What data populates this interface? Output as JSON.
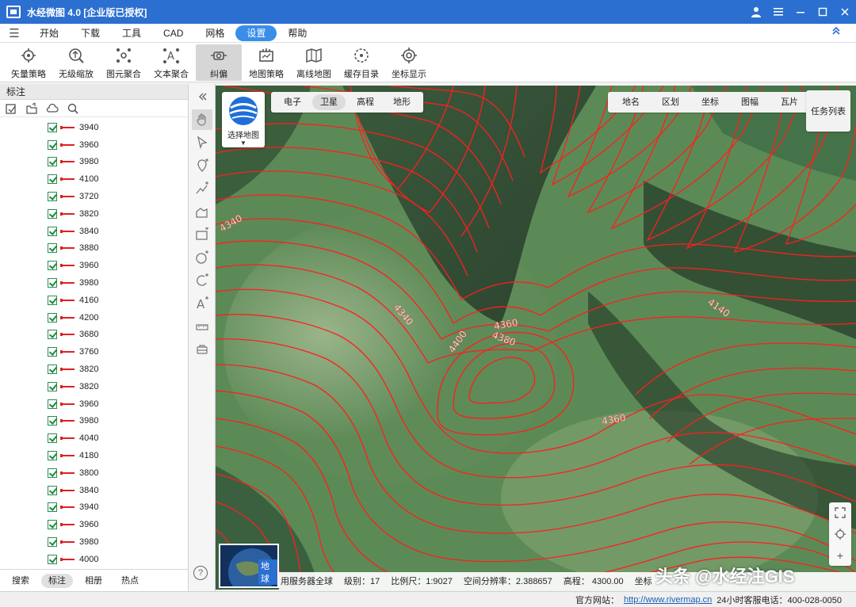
{
  "window": {
    "title": "水经微图 4.0 [企业版已授权]",
    "controls": [
      "user-icon",
      "menu-icon",
      "minimize-icon",
      "maximize-icon",
      "close-icon"
    ]
  },
  "menu": {
    "items": [
      {
        "label": "开始"
      },
      {
        "label": "下载"
      },
      {
        "label": "工具"
      },
      {
        "label": "CAD"
      },
      {
        "label": "网格"
      },
      {
        "label": "设置",
        "active": true
      },
      {
        "label": "帮助"
      }
    ]
  },
  "toolbar": {
    "items": [
      {
        "label": "矢量策略",
        "icon": "vector-strategy-icon"
      },
      {
        "label": "无级缩放",
        "icon": "stepless-zoom-icon"
      },
      {
        "label": "图元聚合",
        "icon": "feature-cluster-icon"
      },
      {
        "label": "文本聚合",
        "icon": "text-cluster-icon"
      },
      {
        "label": "纠偏",
        "icon": "offset-correction-icon",
        "active": true
      },
      {
        "label": "地图策略",
        "icon": "map-strategy-icon"
      },
      {
        "label": "离线地图",
        "icon": "offline-map-icon"
      },
      {
        "label": "缓存目录",
        "icon": "cache-folder-icon"
      },
      {
        "label": "坐标显示",
        "icon": "coordinate-display-icon"
      }
    ]
  },
  "left_panel": {
    "header": "标注",
    "layers": [
      "3940",
      "3960",
      "3980",
      "4100",
      "3720",
      "3820",
      "3840",
      "3880",
      "3960",
      "3980",
      "4160",
      "4200",
      "3680",
      "3760",
      "3820",
      "3820",
      "3960",
      "3980",
      "4040",
      "4180",
      "3800",
      "3840",
      "3940",
      "3960",
      "3980",
      "4000"
    ],
    "tabs": [
      {
        "label": "搜索"
      },
      {
        "label": "标注",
        "active": true
      },
      {
        "label": "相册"
      },
      {
        "label": "热点"
      }
    ]
  },
  "map": {
    "chooser_label": "选择地图",
    "type_tabs": [
      {
        "label": "电子"
      },
      {
        "label": "卫星",
        "active": true
      },
      {
        "label": "高程"
      },
      {
        "label": "地形"
      }
    ],
    "overlay_tabs": [
      "地名",
      "区划",
      "坐标",
      "图幅",
      "瓦片"
    ],
    "task_list": "任务列表",
    "contour_labels": [
      "4340",
      "4340",
      "4400",
      "4360",
      "4380",
      "4140",
      "4360"
    ],
    "minimap_label": "地球",
    "status": {
      "server": "用服务器全球",
      "level": "级别：17",
      "scale": "比例尺：1:9027",
      "resolution": "空间分辨率：2.388657",
      "elevation": "高程：  4300.00",
      "coord": "坐标"
    },
    "watermark": "头条 @水经注GIS"
  },
  "footer": {
    "site_label": "官方网站：",
    "site_url": "http://www.rivermap.cn",
    "phone": "24小时客服电话：400-028-0050"
  },
  "colors": {
    "titlebar": "#2b6fd0",
    "accent": "#3b8ee8",
    "contour": "#ff2020"
  }
}
